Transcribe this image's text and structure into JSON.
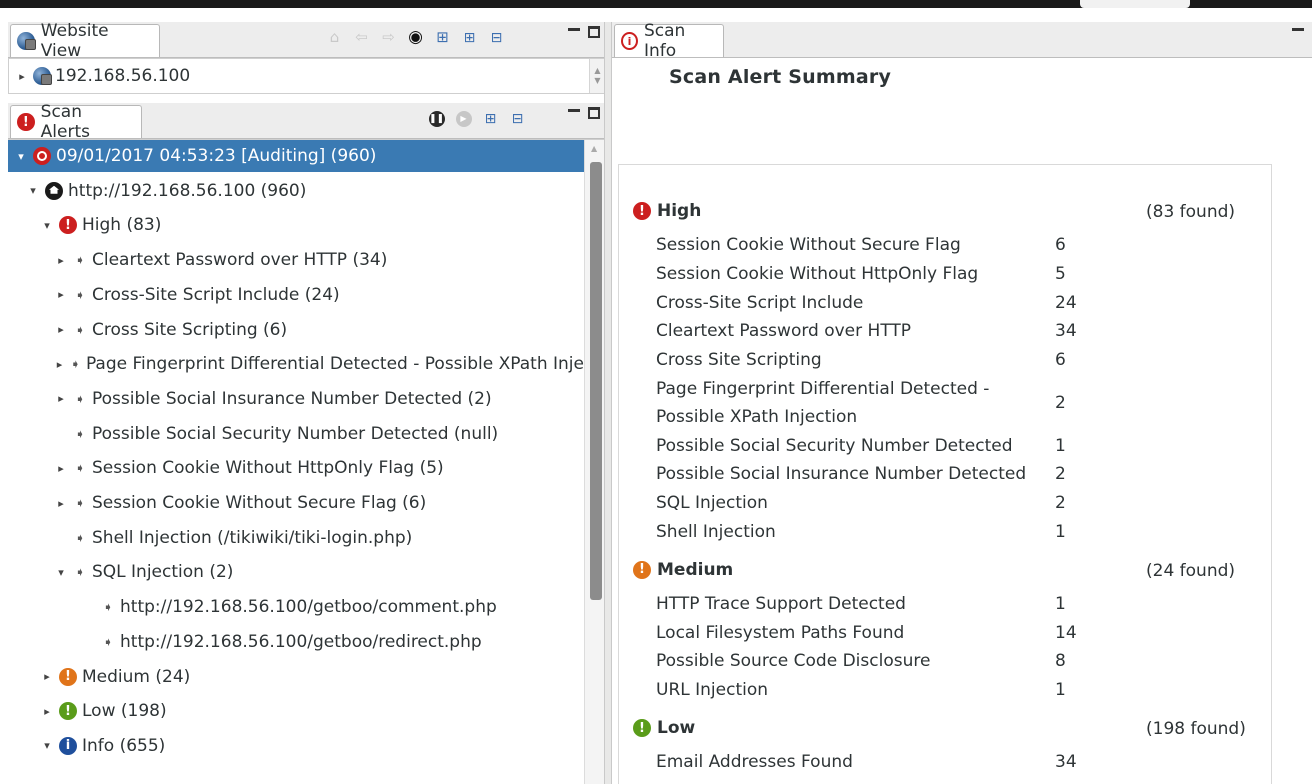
{
  "website_view": {
    "tab_label": "Website View",
    "address": "192.168.56.100"
  },
  "scan_alerts": {
    "tab_label": "Scan Alerts",
    "tree": [
      {
        "label": "09/01/2017 04:53:23 [Auditing]  (960)",
        "level": 0,
        "icon": "scan-target-icon",
        "twisty": "expanded",
        "selected": true
      },
      {
        "label": "http://192.168.56.100 (960)",
        "level": 1,
        "icon": "host-icon",
        "twisty": "expanded"
      },
      {
        "label": "High (83)",
        "level": 2,
        "icon": "high-severity-icon",
        "twisty": "expanded"
      },
      {
        "label": "Cleartext Password over HTTP (34)",
        "level": 3,
        "icon": "alert-arrow-icon",
        "twisty": "collapsed"
      },
      {
        "label": "Cross-Site Script Include (24)",
        "level": 3,
        "icon": "alert-arrow-icon",
        "twisty": "collapsed"
      },
      {
        "label": "Cross Site Scripting (6)",
        "level": 3,
        "icon": "alert-arrow-icon",
        "twisty": "collapsed"
      },
      {
        "label": "Page Fingerprint Differential Detected - Possible XPath Inje",
        "level": 3,
        "icon": "alert-arrow-icon",
        "twisty": "collapsed"
      },
      {
        "label": "Possible Social Insurance Number Detected (2)",
        "level": 3,
        "icon": "alert-arrow-icon",
        "twisty": "collapsed"
      },
      {
        "label": "Possible Social Security Number Detected (null)",
        "level": 3,
        "icon": "alert-arrow-icon",
        "twisty": "none"
      },
      {
        "label": "Session Cookie Without HttpOnly Flag  (5)",
        "level": 3,
        "icon": "alert-arrow-icon",
        "twisty": "collapsed"
      },
      {
        "label": "Session Cookie Without Secure Flag  (6)",
        "level": 3,
        "icon": "alert-arrow-icon",
        "twisty": "collapsed"
      },
      {
        "label": "Shell Injection (/tikiwiki/tiki-login.php)",
        "level": 3,
        "icon": "alert-arrow-icon",
        "twisty": "none"
      },
      {
        "label": "SQL Injection (2)",
        "level": 3,
        "icon": "alert-arrow-icon",
        "twisty": "expanded"
      },
      {
        "label": "http://192.168.56.100/getboo/comment.php",
        "level": 4,
        "icon": "alert-arrow-icon",
        "twisty": "none"
      },
      {
        "label": "http://192.168.56.100/getboo/redirect.php",
        "level": 4,
        "icon": "alert-arrow-icon",
        "twisty": "none"
      },
      {
        "label": "Medium (24)",
        "level": 2,
        "icon": "medium-severity-icon",
        "twisty": "collapsed"
      },
      {
        "label": "Low (198)",
        "level": 2,
        "icon": "low-severity-icon",
        "twisty": "collapsed"
      },
      {
        "label": "Info (655)",
        "level": 2,
        "icon": "info-severity-icon",
        "twisty": "expanded"
      }
    ]
  },
  "scan_info": {
    "tab_label": "Scan Info",
    "title": "Scan Alert Summary",
    "sections": [
      {
        "severity": "High",
        "icon": "high-severity-icon",
        "found": "(83 found)",
        "alerts": [
          {
            "name": "Session Cookie Without Secure Flag",
            "count": "6"
          },
          {
            "name": "Session Cookie Without HttpOnly Flag",
            "count": "5"
          },
          {
            "name": "Cross-Site Script Include",
            "count": "24"
          },
          {
            "name": "Cleartext Password over HTTP",
            "count": "34"
          },
          {
            "name": "Cross Site Scripting",
            "count": "6"
          },
          {
            "name": "Page Fingerprint Differential Detected -\nPossible XPath Injection",
            "count": "2"
          },
          {
            "name": "Possible Social Security Number Detected",
            "count": "1"
          },
          {
            "name": "Possible Social Insurance Number Detected",
            "count": "2"
          },
          {
            "name": "SQL Injection",
            "count": "2"
          },
          {
            "name": "Shell Injection",
            "count": "1"
          }
        ]
      },
      {
        "severity": "Medium",
        "icon": "medium-severity-icon",
        "found": "(24 found)",
        "alerts": [
          {
            "name": "HTTP Trace Support Detected",
            "count": "1"
          },
          {
            "name": "Local Filesystem Paths Found",
            "count": "14"
          },
          {
            "name": "Possible Source Code Disclosure",
            "count": "8"
          },
          {
            "name": "URL Injection",
            "count": "1"
          }
        ]
      },
      {
        "severity": "Low",
        "icon": "low-severity-icon",
        "found": "(198 found)",
        "alerts": [
          {
            "name": "Email Addresses Found",
            "count": "34"
          }
        ]
      }
    ]
  },
  "colors": {
    "selection": "#3a7ab3",
    "high": "#cc1f1f",
    "medium": "#e0741a",
    "low": "#5a9c1a",
    "info": "#1f4f9c"
  }
}
